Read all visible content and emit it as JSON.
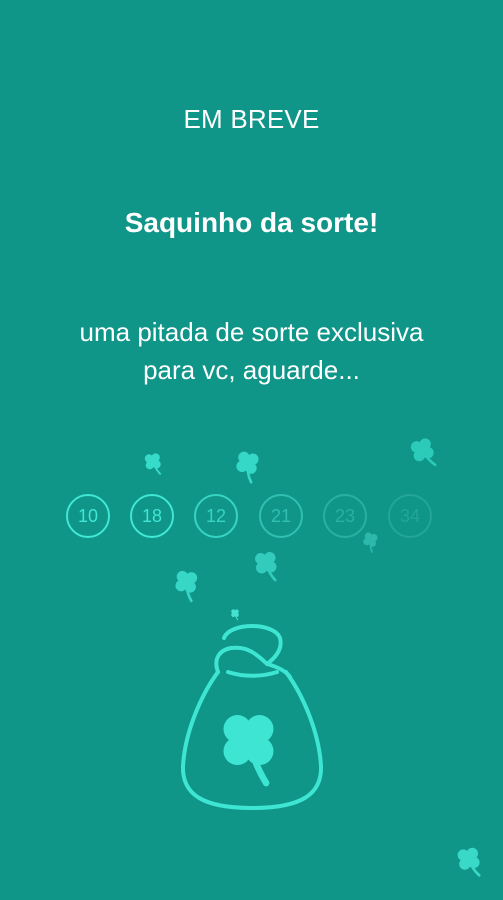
{
  "header": {
    "eyebrow": "EM BREVE",
    "title": "Saquinho da sorte!",
    "subtitle_line1": "uma pitada de sorte exclusiva",
    "subtitle_line2": "para vc, aguarde..."
  },
  "lucky_numbers": [
    "10",
    "18",
    "12",
    "21",
    "23",
    "34"
  ],
  "icons": {
    "clover": "clover-icon",
    "bag": "lucky-bag-icon"
  },
  "colors": {
    "background": "#0f9689",
    "accent": "#41e6d5",
    "text": "#ffffff"
  }
}
